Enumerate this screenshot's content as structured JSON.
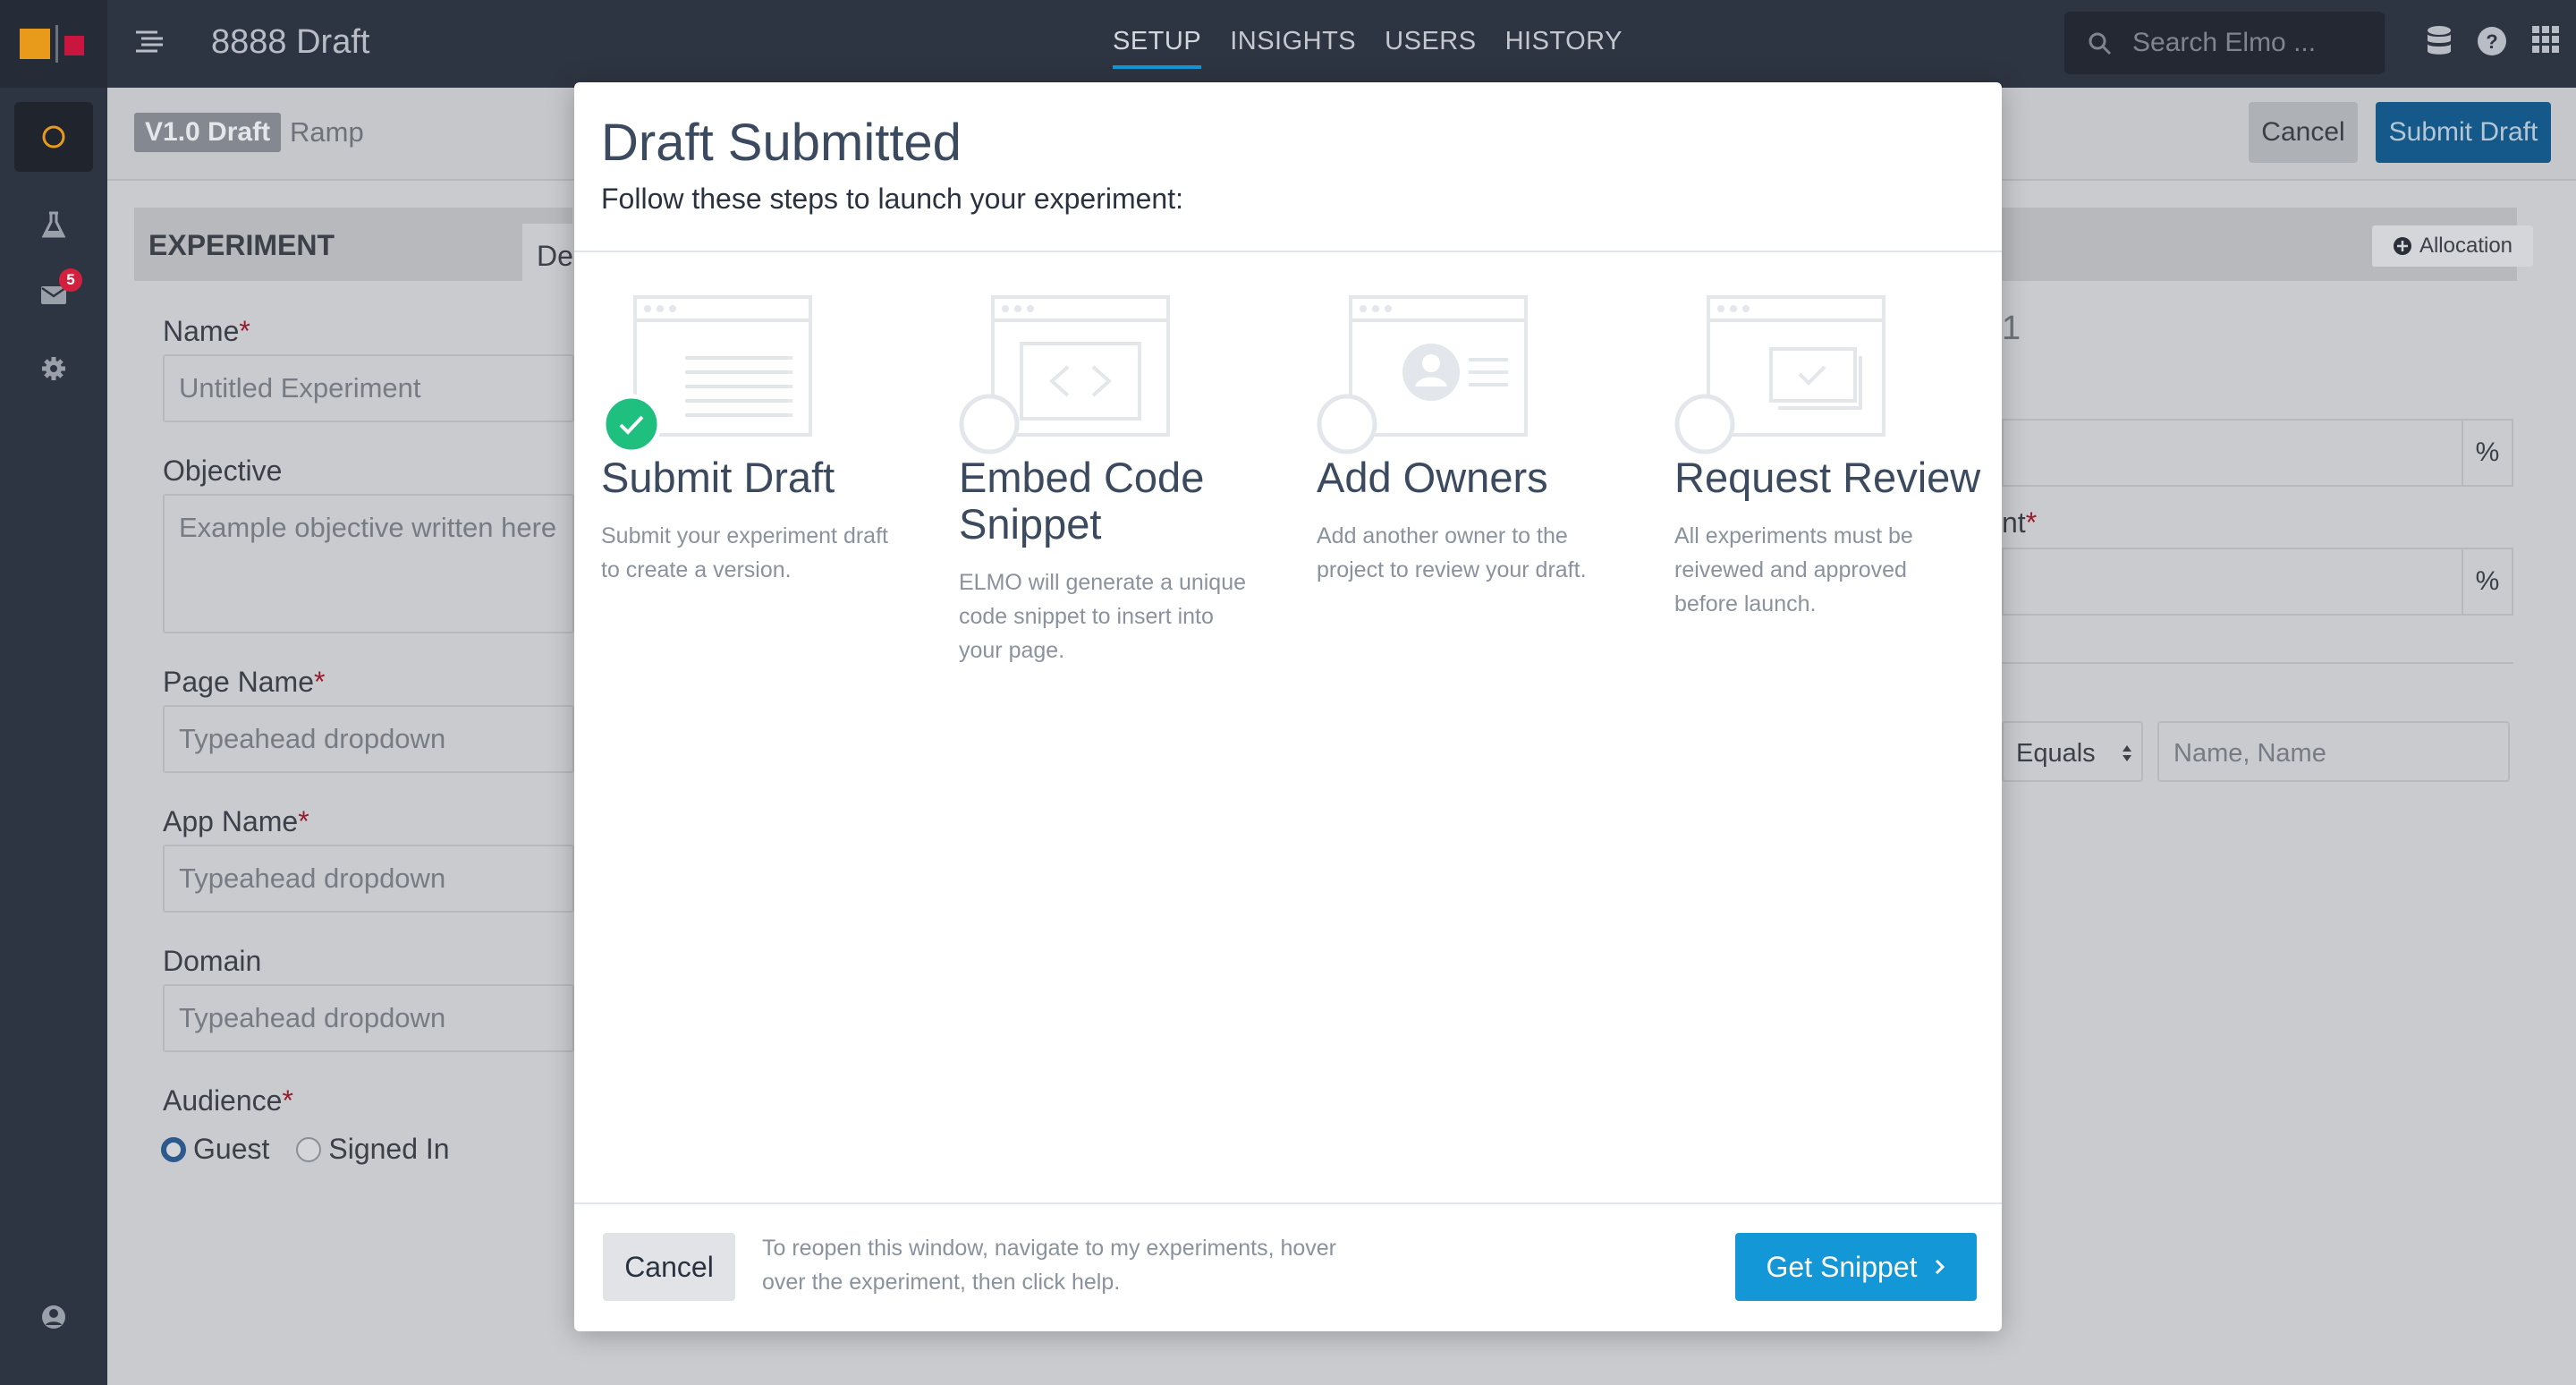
{
  "app": {
    "title": "8888 Draft",
    "notification_count": "5",
    "colors": {
      "accent": "#1497d6",
      "sidebar": "#2e3542",
      "success": "#1fbf7f",
      "required": "#c8163f"
    }
  },
  "nav": {
    "tabs": [
      {
        "label": "SETUP",
        "active": true
      },
      {
        "label": "INSIGHTS",
        "active": false
      },
      {
        "label": "USERS",
        "active": false
      },
      {
        "label": "HISTORY",
        "active": false
      }
    ]
  },
  "search": {
    "placeholder": "Search Elmo ..."
  },
  "subheader": {
    "version": "V1.0 Draft",
    "status": "Ramp",
    "cancel_label": "Cancel",
    "submit_label": "Submit Draft"
  },
  "experiment": {
    "section_title": "EXPERIMENT",
    "tab_partial": "De",
    "allocation_label": "Allocation",
    "fields": {
      "name": {
        "label": "Name",
        "placeholder": "Untitled Experiment"
      },
      "objective": {
        "label": "Objective",
        "placeholder": "Example objective written here"
      },
      "page_name": {
        "label": "Page Name",
        "placeholder": "Typeahead dropdown"
      },
      "app_name": {
        "label": "App Name",
        "placeholder": "Typeahead dropdown"
      },
      "domain": {
        "label": "Domain",
        "placeholder": "Typeahead dropdown"
      },
      "audience": {
        "label": "Audience",
        "options": [
          "Guest",
          "Signed In"
        ],
        "selected": "Guest"
      }
    },
    "right_panel": {
      "partial_value": "1",
      "partial_label": "nt",
      "percent_symbol": "%",
      "operator": "Equals",
      "name_placeholder": "Name, Name"
    }
  },
  "modal": {
    "title": "Draft Submitted",
    "subtitle": "Follow these steps to launch your experiment:",
    "steps": [
      {
        "title": "Submit Draft",
        "description": "Submit your experiment draft to create a version.",
        "completed": true,
        "icon": "document-lines-icon"
      },
      {
        "title": "Embed Code Snippet",
        "description": "ELMO will generate a unique code snippet to insert into your page.",
        "completed": false,
        "icon": "code-brackets-icon"
      },
      {
        "title": "Add Owners",
        "description": "Add another owner to the project to review your draft.",
        "completed": false,
        "icon": "user-card-icon"
      },
      {
        "title": "Request Review",
        "description": "All experiments must be reivewed and approved before launch.",
        "completed": false,
        "icon": "check-window-icon"
      }
    ],
    "cancel_label": "Cancel",
    "footer_note": "To reopen this window, navigate to my experiments, hover over the experiment, then click help.",
    "primary_label": "Get Snippet"
  }
}
